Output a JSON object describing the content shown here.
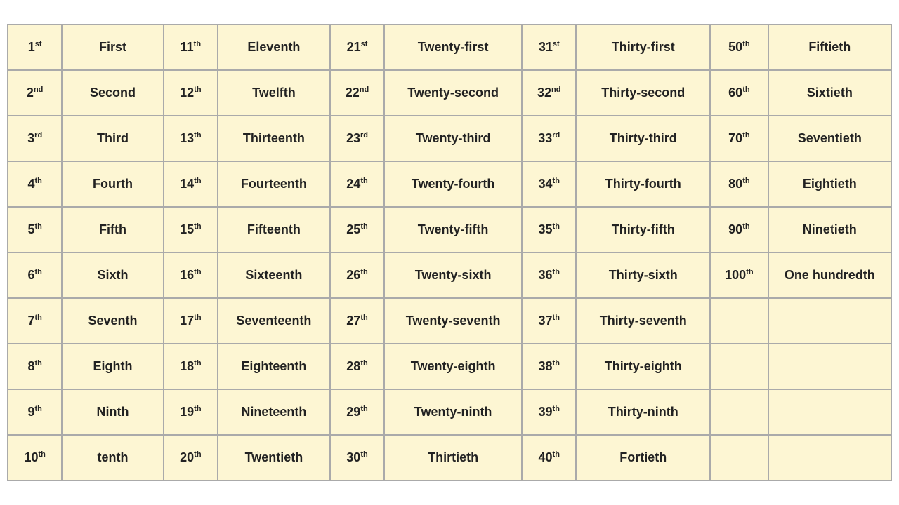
{
  "rows": [
    {
      "c1n": "1",
      "c1s": "st",
      "c2": "First",
      "c3n": "11",
      "c3s": "th",
      "c4": "Eleventh",
      "c5n": "21",
      "c5s": "st",
      "c6": "Twenty-first",
      "c7n": "31",
      "c7s": "st",
      "c8": "Thirty-first",
      "c9n": "50",
      "c9s": "th",
      "c10": "Fiftieth"
    },
    {
      "c1n": "2",
      "c1s": "nd",
      "c2": "Second",
      "c3n": "12",
      "c3s": "th",
      "c4": "Twelfth",
      "c5n": "22",
      "c5s": "nd",
      "c6": "Twenty-second",
      "c7n": "32",
      "c7s": "nd",
      "c8": "Thirty-second",
      "c9n": "60",
      "c9s": "th",
      "c10": "Sixtieth"
    },
    {
      "c1n": "3",
      "c1s": "rd",
      "c2": "Third",
      "c3n": "13",
      "c3s": "th",
      "c4": "Thirteenth",
      "c5n": "23",
      "c5s": "rd",
      "c6": "Twenty-third",
      "c7n": "33",
      "c7s": "rd",
      "c8": "Thirty-third",
      "c9n": "70",
      "c9s": "th",
      "c10": "Seventieth"
    },
    {
      "c1n": "4",
      "c1s": "th",
      "c2": "Fourth",
      "c3n": "14",
      "c3s": "th",
      "c4": "Fourteenth",
      "c5n": "24",
      "c5s": "th",
      "c6": "Twenty-fourth",
      "c7n": "34",
      "c7s": "th",
      "c8": "Thirty-fourth",
      "c9n": "80",
      "c9s": "th",
      "c10": "Eightieth"
    },
    {
      "c1n": "5",
      "c1s": "th",
      "c2": "Fifth",
      "c3n": "15",
      "c3s": "th",
      "c4": "Fifteenth",
      "c5n": "25",
      "c5s": "th",
      "c6": "Twenty-fifth",
      "c7n": "35",
      "c7s": "th",
      "c8": "Thirty-fifth",
      "c9n": "90",
      "c9s": "th",
      "c10": "Ninetieth"
    },
    {
      "c1n": "6",
      "c1s": "th",
      "c2": "Sixth",
      "c3n": "16",
      "c3s": "th",
      "c4": "Sixteenth",
      "c5n": "26",
      "c5s": "th",
      "c6": "Twenty-sixth",
      "c7n": "36",
      "c7s": "th",
      "c8": "Thirty-sixth",
      "c9n": "100",
      "c9s": "th",
      "c10": "One hundredth"
    },
    {
      "c1n": "7",
      "c1s": "th",
      "c2": "Seventh",
      "c3n": "17",
      "c3s": "th",
      "c4": "Seventeenth",
      "c5n": "27",
      "c5s": "th",
      "c6": "Twenty-seventh",
      "c7n": "37",
      "c7s": "th",
      "c8": "Thirty-seventh",
      "c9n": "",
      "c9s": "",
      "c10": ""
    },
    {
      "c1n": "8",
      "c1s": "th",
      "c2": "Eighth",
      "c3n": "18",
      "c3s": "th",
      "c4": "Eighteenth",
      "c5n": "28",
      "c5s": "th",
      "c6": "Twenty-eighth",
      "c7n": "38",
      "c7s": "th",
      "c8": "Thirty-eighth",
      "c9n": "",
      "c9s": "",
      "c10": ""
    },
    {
      "c1n": "9",
      "c1s": "th",
      "c2": "Ninth",
      "c3n": "19",
      "c3s": "th",
      "c4": "Nineteenth",
      "c5n": "29",
      "c5s": "th",
      "c6": "Twenty-ninth",
      "c7n": "39",
      "c7s": "th",
      "c8": "Thirty-ninth",
      "c9n": "",
      "c9s": "",
      "c10": ""
    },
    {
      "c1n": "10",
      "c1s": "th",
      "c2": "tenth",
      "c3n": "20",
      "c3s": "th",
      "c4": "Twentieth",
      "c5n": "30",
      "c5s": "th",
      "c6": "Thirtieth",
      "c7n": "40",
      "c7s": "th",
      "c8": "Fortieth",
      "c9n": "",
      "c9s": "",
      "c10": ""
    }
  ]
}
